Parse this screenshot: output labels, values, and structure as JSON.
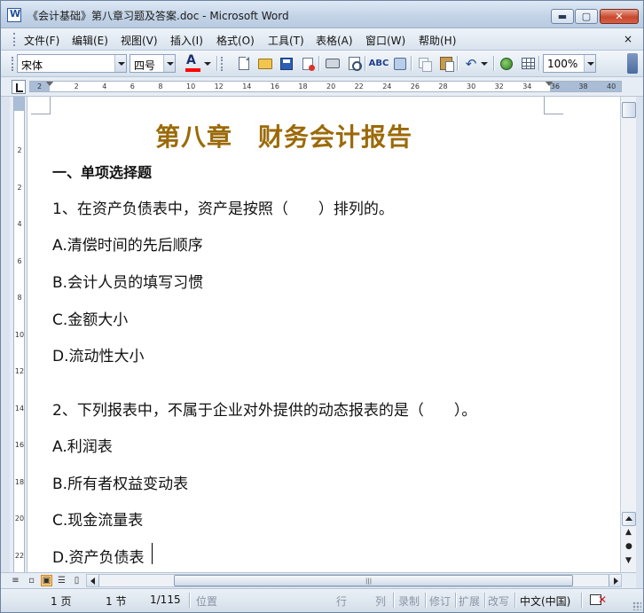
{
  "window": {
    "title": "《会计基础》第八章习题及答案.doc - Microsoft Word",
    "controls": {
      "minimize": "▬",
      "maximize": "▢",
      "close": "✕"
    }
  },
  "menu": {
    "items": [
      "文件(F)",
      "编辑(E)",
      "视图(V)",
      "插入(I)",
      "格式(O)",
      "工具(T)",
      "表格(A)",
      "窗口(W)",
      "帮助(H)"
    ],
    "close_doc": "×"
  },
  "toolbar": {
    "font_name": "宋体",
    "font_size": "四号",
    "font_color_letter": "A",
    "font_color": "#ff0000",
    "spell_label": "ABC",
    "zoom": "100%",
    "icons": [
      "new-document-icon",
      "open-folder-icon",
      "save-icon",
      "permission-icon",
      "print-icon",
      "print-preview-icon",
      "spelling-icon",
      "research-icon",
      "copy-icon",
      "paste-icon",
      "undo-icon",
      "hyperlink-icon",
      "table-icon"
    ]
  },
  "ruler": {
    "numbers": [
      "2",
      "2",
      "4",
      "6",
      "8",
      "10",
      "12",
      "14",
      "16",
      "18",
      "20",
      "22",
      "24",
      "26",
      "28",
      "30",
      "32",
      "34",
      "36",
      "38",
      "40"
    ],
    "vertical_numbers": [
      "2",
      "2",
      "4",
      "6",
      "8",
      "10",
      "12",
      "14",
      "16",
      "18",
      "20",
      "22",
      "24"
    ]
  },
  "document": {
    "title": "第八章　财务会计报告",
    "section_heading": "一、单项选择题",
    "paragraphs": [
      "1、在资产负债表中，资产是按照（　　）排列的。",
      "A.清偿时间的先后顺序",
      "B.会计人员的填写习惯",
      "C.金额大小",
      "D.流动性大小",
      "2、下列报表中，不属于企业对外提供的动态报表的是（　　）。",
      "A.利润表",
      "B.所有者权益变动表",
      "C.现金流量表",
      "D.资产负债表"
    ],
    "title_color": "#9b6a08"
  },
  "statusbar": {
    "page": "1 页",
    "section": "1 节",
    "page_of": "1/115",
    "position": "位置",
    "line": "行",
    "column": "列",
    "rec": "录制",
    "trk": "修订",
    "ext": "扩展",
    "ovr": "改写",
    "language": "中文(中国)"
  }
}
